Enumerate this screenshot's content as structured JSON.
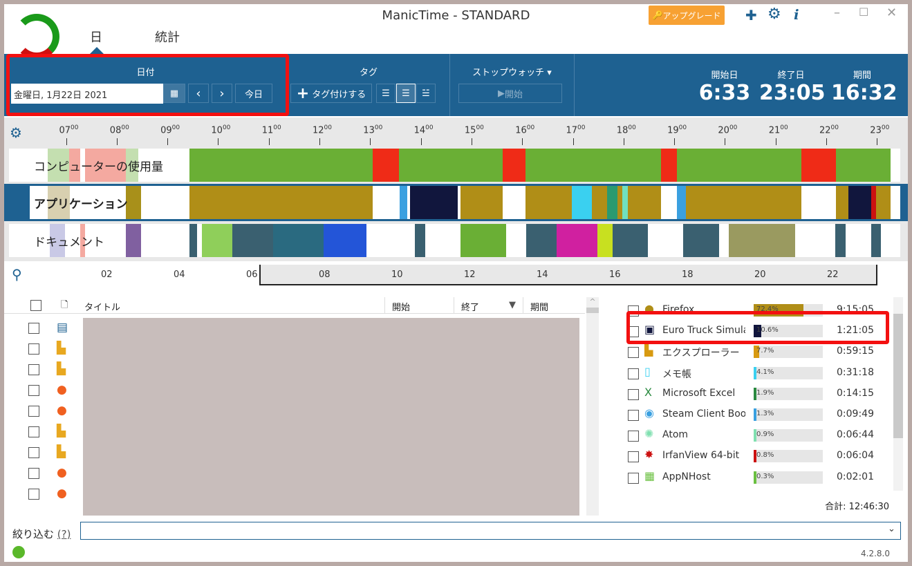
{
  "window": {
    "title": "ManicTime - STANDARD",
    "upgrade": "アップグレード",
    "version": "4.2.8.0"
  },
  "nav": {
    "tabs": [
      "日",
      "統計"
    ]
  },
  "date": {
    "header": "日付",
    "value": "金曜日, 1月22日 2021",
    "today": "今日"
  },
  "tag": {
    "header": "タグ",
    "add": "タグ付けする"
  },
  "stopwatch": {
    "header": "ストップウォッチ",
    "start": "開始"
  },
  "summary": {
    "start_label": "開始日",
    "end_label": "終了日",
    "duration_label": "期間",
    "start": "6:33",
    "end": "23:05",
    "duration": "16:32"
  },
  "timeline": {
    "hours": [
      "07",
      "08",
      "09",
      "10",
      "11",
      "12",
      "13",
      "14",
      "15",
      "16",
      "17",
      "18",
      "19",
      "20",
      "21",
      "22",
      "23"
    ],
    "minute": "00",
    "tracks": [
      "コンピューターの使用量",
      "アプリケーション",
      "ドキュメント"
    ],
    "usage_segments": [
      [
        6.55,
        6.98,
        "#c4dfb0"
      ],
      [
        6.98,
        7.0,
        "#f4a9a0"
      ],
      [
        7.0,
        7.2,
        "#f4a9a0"
      ],
      [
        7.3,
        7.65,
        "#f4a9a0"
      ],
      [
        7.65,
        8.1,
        "#f4a9a0"
      ],
      [
        8.1,
        8.35,
        "#c4dfb0"
      ],
      [
        9.35,
        12.97,
        "#6aaf35"
      ],
      [
        12.97,
        13.49,
        "#ef2b17"
      ],
      [
        13.49,
        15.53,
        "#6aaf35"
      ],
      [
        15.53,
        15.98,
        "#ef2b17"
      ],
      [
        15.98,
        18.66,
        "#6aaf35"
      ],
      [
        18.66,
        18.97,
        "#ef2b17"
      ],
      [
        18.97,
        21.43,
        "#6aaf35"
      ],
      [
        21.43,
        22.11,
        "#ef2b17"
      ],
      [
        22.11,
        23.19,
        "#6aaf35"
      ]
    ],
    "app_segments": [
      [
        6.55,
        7.0,
        "#d8d0b0"
      ],
      [
        8.1,
        8.4,
        "#a8901a"
      ],
      [
        9.35,
        12.97,
        "#b08e17"
      ],
      [
        13.5,
        13.65,
        "#3aa0e0"
      ],
      [
        13.7,
        14.65,
        "#11163d"
      ],
      [
        14.7,
        15.53,
        "#b08e17"
      ],
      [
        15.98,
        16.9,
        "#b08e17"
      ],
      [
        16.9,
        17.3,
        "#3ad0f0"
      ],
      [
        17.3,
        18.66,
        "#b08e17"
      ],
      [
        17.6,
        17.8,
        "#2a9a70"
      ],
      [
        17.9,
        18.0,
        "#70e0c0"
      ],
      [
        18.97,
        19.15,
        "#3aa0e0"
      ],
      [
        19.15,
        21.43,
        "#b08e17"
      ],
      [
        22.11,
        22.35,
        "#b08e17"
      ],
      [
        22.35,
        22.8,
        "#11163d"
      ],
      [
        22.8,
        22.9,
        "#cc1111"
      ],
      [
        22.9,
        23.19,
        "#b08e17"
      ]
    ],
    "doc_segments": [
      [
        6.6,
        6.9,
        "#c9c9e6"
      ],
      [
        7.2,
        7.3,
        "#f4a9a0"
      ],
      [
        8.1,
        8.4,
        "#8060a0"
      ],
      [
        9.35,
        9.5,
        "#3a6070"
      ],
      [
        9.6,
        10.2,
        "#8fcf5a"
      ],
      [
        10.2,
        11.0,
        "#3a6070"
      ],
      [
        11.0,
        12.0,
        "#2a6a80"
      ],
      [
        12.0,
        12.85,
        "#2355d8"
      ],
      [
        13.8,
        14.0,
        "#3a6070"
      ],
      [
        14.7,
        15.6,
        "#6aaf35"
      ],
      [
        16.0,
        16.6,
        "#3a6070"
      ],
      [
        16.6,
        17.4,
        "#d020a0"
      ],
      [
        17.4,
        17.7,
        "#c8e020"
      ],
      [
        17.7,
        18.4,
        "#3a6070"
      ],
      [
        19.1,
        19.8,
        "#3a6070"
      ],
      [
        20.0,
        21.3,
        "#9a9a60"
      ],
      [
        22.1,
        22.3,
        "#3a6070"
      ],
      [
        22.8,
        23.0,
        "#3a6070"
      ]
    ],
    "overview_ticks": [
      "02",
      "04",
      "06",
      "08",
      "10",
      "12",
      "14",
      "16",
      "18",
      "20",
      "22"
    ]
  },
  "list": {
    "headers": {
      "title": "タイトル",
      "start": "開始",
      "end": "終了",
      "duration": "期間"
    },
    "icons": [
      "window",
      "explorer",
      "explorer",
      "firefox",
      "firefox",
      "explorer",
      "explorer",
      "firefox",
      "firefox"
    ]
  },
  "apps": [
    {
      "name": "Firefox",
      "pct": 72.4,
      "pct_label": "72.4%",
      "time": "9:15:05",
      "color": "#b08e17"
    },
    {
      "name": "Euro Truck Simula",
      "pct": 10.6,
      "pct_label": "10.6%",
      "time": "1:21:05",
      "color": "#11163d"
    },
    {
      "name": "エクスプローラー",
      "pct": 7.7,
      "pct_label": "7.7%",
      "time": "0:59:15",
      "color": "#d89a10"
    },
    {
      "name": "メモ帳",
      "pct": 4.1,
      "pct_label": "4.1%",
      "time": "0:31:18",
      "color": "#3ad0f0"
    },
    {
      "name": "Microsoft Excel",
      "pct": 1.9,
      "pct_label": "1.9%",
      "time": "0:14:15",
      "color": "#2a8a40"
    },
    {
      "name": "Steam Client Boot",
      "pct": 1.3,
      "pct_label": "1.3%",
      "time": "0:09:49",
      "color": "#3aa0e0"
    },
    {
      "name": "Atom",
      "pct": 0.9,
      "pct_label": "0.9%",
      "time": "0:06:44",
      "color": "#80e0b0"
    },
    {
      "name": "IrfanView 64-bit",
      "pct": 0.8,
      "pct_label": "0.8%",
      "time": "0:06:04",
      "color": "#cc1111"
    },
    {
      "name": "AppNHost",
      "pct": 0.3,
      "pct_label": "0.3%",
      "time": "0:02:01",
      "color": "#6ac040"
    }
  ],
  "total": "合計: 12:46:30",
  "filter": {
    "label": "絞り込む",
    "help": "(?)",
    "value": ""
  },
  "colors": {
    "header_blue": "#1e6191",
    "highlight_red": "#f31010"
  }
}
